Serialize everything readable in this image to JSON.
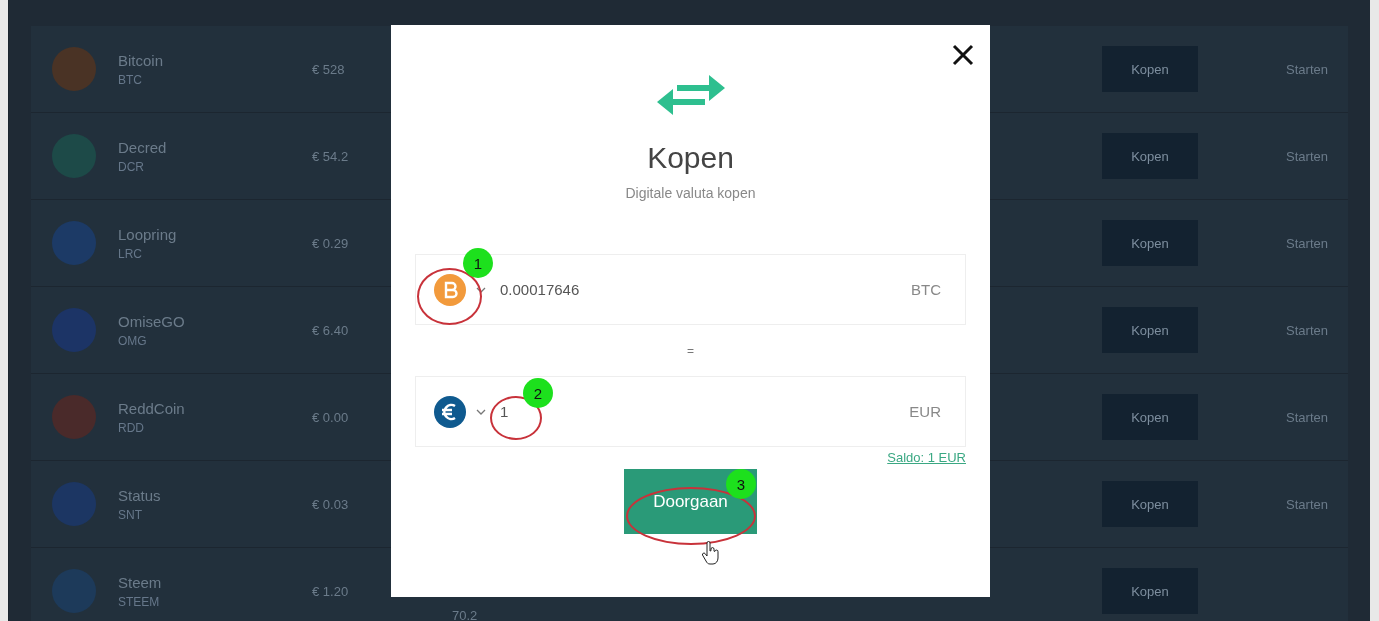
{
  "coins": [
    {
      "name": "Bitcoin",
      "symbol": "BTC",
      "price": "€ 528",
      "buy": "Kopen",
      "action": "Starten",
      "color": "#4a3325"
    },
    {
      "name": "Decred",
      "symbol": "DCR",
      "price": "€ 54.2",
      "buy": "Kopen",
      "action": "Starten",
      "color": "#1d4a48"
    },
    {
      "name": "Loopring",
      "symbol": "LRC",
      "price": "€ 0.29",
      "buy": "Kopen",
      "action": "Starten",
      "color": "#1c3a66"
    },
    {
      "name": "OmiseGO",
      "symbol": "OMG",
      "price": "€ 6.40",
      "buy": "Kopen",
      "action": "Starten",
      "color": "#1c3466"
    },
    {
      "name": "ReddCoin",
      "symbol": "RDD",
      "price": "€ 0.00",
      "buy": "Kopen",
      "action": "Starten",
      "color": "#4a2a2a"
    },
    {
      "name": "Status",
      "symbol": "SNT",
      "price": "€ 0.03",
      "buy": "Kopen",
      "action": "Starten",
      "color": "#1c3663"
    },
    {
      "name": "Steem",
      "symbol": "STEEM",
      "price": "€ 1.20",
      "column_3": "70.2",
      "buy": "Kopen",
      "color": "#1d3a5a"
    }
  ],
  "modal": {
    "title": "Kopen",
    "subtitle": "Digitale valuta kopen",
    "fields": [
      {
        "kind": "btc",
        "value": "0.00017646",
        "unit": "BTC"
      },
      {
        "kind": "eur",
        "value": "1",
        "unit": "EUR"
      }
    ],
    "equals": "=",
    "balance_link": "Saldo: 1 EUR",
    "submit": "Doorgaan",
    "annotations": [
      "1",
      "2",
      "3"
    ]
  }
}
